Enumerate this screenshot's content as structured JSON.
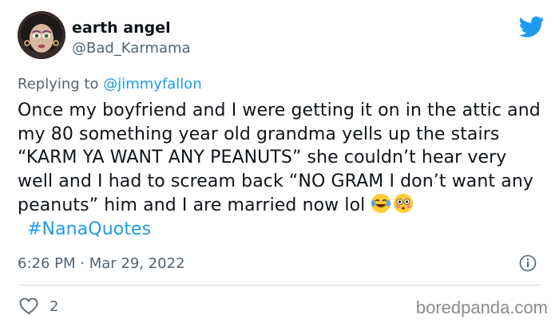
{
  "tweet": {
    "author_name": "earth angel",
    "author_handle": "@Bad_Karmama",
    "avatar_icon": "avatar-icon",
    "platform_icon": "twitter-bird-icon",
    "reply_prefix": "Replying to",
    "reply_to": "@jimmyfallon",
    "text": "Once my boyfriend and I were getting it on in the attic and my 80 something year old grandma yells up the stairs “KARM YA WANT ANY PEANUTS” she couldn’t hear very well and I had to scream back “NO GRAM I don’t want any peanuts” him and I are married now lol",
    "emojis": [
      "laughing-crying-emoji",
      "flushed-face-emoji"
    ],
    "hashtag": "#NanaQuotes",
    "timestamp": "6:26 PM · Mar 29, 2022",
    "like_count": "2"
  },
  "watermark": "boredpanda.com",
  "colors": {
    "link": "#1d9bf0",
    "secondary_text": "#536471",
    "primary_text": "#0f1419",
    "divider": "#cfd9de"
  }
}
